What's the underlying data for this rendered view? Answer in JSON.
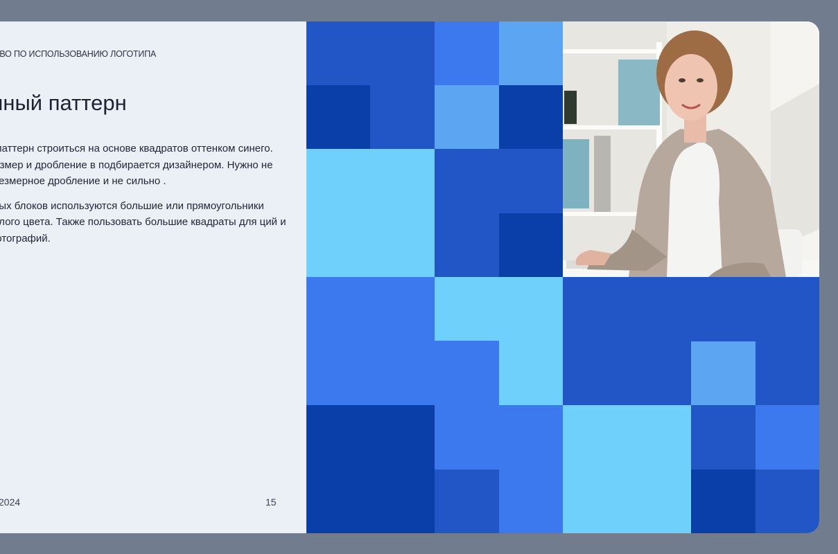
{
  "header": "ТВО ПО ИСПОЛЬЗОВАНИЮ ЛОГОТИПА",
  "title": "енный паттерн",
  "paragraphs": [
    "й паттерн строиться на основе квадратов оттенком синего. Размер и дробление в подбирается дизайнером. Нужно не чрезмерное дробление и не сильно .",
    "овых блоков используются большие или прямоугольники белого цвета. Также пользовать большие квадраты для ций и фотографий."
  ],
  "footer": {
    "year": "2024",
    "page": "15"
  },
  "colors": {
    "frame": "#717d8f",
    "panel": "#eaf0f6",
    "blue_dark": "#0a3ea9",
    "blue_mid": "#2255c6",
    "blue": "#3c78ee",
    "blue_light": "#5ba5f2",
    "cyan": "#6fd1fb"
  },
  "photo": {
    "subject": "woman-at-desk"
  }
}
